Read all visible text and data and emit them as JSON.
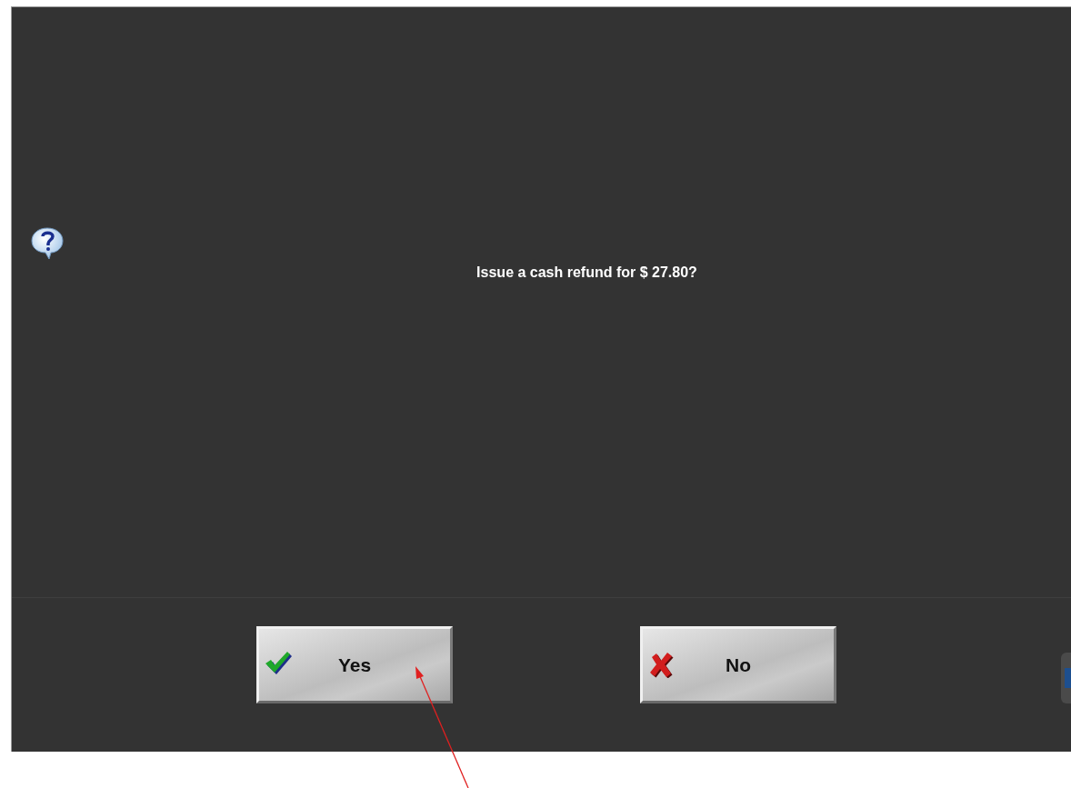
{
  "dialog": {
    "message": "Issue a cash refund for $ 27.80?"
  },
  "buttons": [
    {
      "label": "Yes",
      "kind": "confirm"
    },
    {
      "label": "No",
      "kind": "cancel"
    }
  ]
}
